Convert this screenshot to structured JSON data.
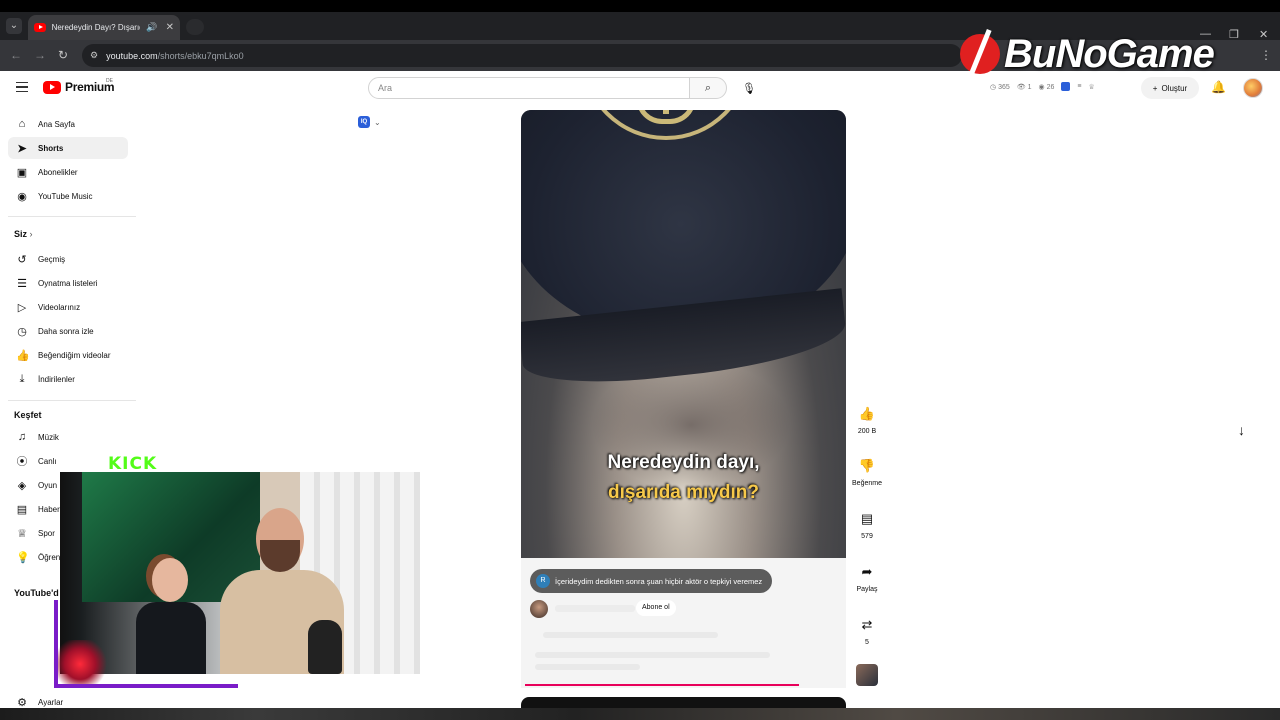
{
  "browser": {
    "tab_title": "Neredeydin Dayı? Dışarıda",
    "url_host": "youtube.com",
    "url_path": "/shorts/ebku7qmLko0"
  },
  "watermark": {
    "text": "BuNoGame"
  },
  "header": {
    "logo": "Premium",
    "country": "DE",
    "search_placeholder": "Ara",
    "stats": [
      "365",
      "1",
      "26"
    ],
    "create_label": "Oluştur"
  },
  "sidebar": {
    "main": [
      {
        "label": "Ana Sayfa",
        "icon": "home-icon"
      },
      {
        "label": "Shorts",
        "icon": "shorts-icon"
      },
      {
        "label": "Abonelikler",
        "icon": "subscriptions-icon"
      },
      {
        "label": "YouTube Music",
        "icon": "music-icon"
      }
    ],
    "you_heading": "Siz",
    "you": [
      {
        "label": "Geçmiş",
        "icon": "history-icon"
      },
      {
        "label": "Oynatma listeleri",
        "icon": "playlist-icon"
      },
      {
        "label": "Videolarınız",
        "icon": "video-icon"
      },
      {
        "label": "Daha sonra izle",
        "icon": "clock-icon"
      },
      {
        "label": "Beğendiğim videolar",
        "icon": "like-icon"
      },
      {
        "label": "İndirilenler",
        "icon": "download-icon"
      }
    ],
    "explore_heading": "Keşfet",
    "explore": [
      {
        "label": "Müzik",
        "icon": "music-note-icon"
      },
      {
        "label": "Canlı",
        "icon": "live-icon"
      },
      {
        "label": "Oyun",
        "icon": "gaming-icon"
      },
      {
        "label": "Haber",
        "icon": "news-icon"
      },
      {
        "label": "Spor",
        "icon": "trophy-icon"
      },
      {
        "label": "Öğren",
        "icon": "bulb-icon"
      }
    ],
    "more_heading": "YouTube'd",
    "settings_label": "Ayarlar"
  },
  "short": {
    "subtitle_line1": "Neredeydin dayı,",
    "subtitle_line2": "dışarıda mıydın?",
    "comment_initial": "R",
    "comment_text": "İçerideydim dedikten sonra şuan hiçbir  aktör o tepkiyi veremez",
    "subscribe_label": "Abone ol"
  },
  "actions": {
    "likes": "200 B",
    "dislike_label": "Beğenme",
    "comments": "579",
    "share_label": "Paylaş",
    "remix_count": "5"
  },
  "overlay": {
    "kick_text": "KICK"
  },
  "colors": {
    "youtube_red": "#ff0000",
    "kick_green": "#53fc18",
    "subtitle_yellow": "#f7c94a",
    "progress_pink": "#e8005a"
  }
}
